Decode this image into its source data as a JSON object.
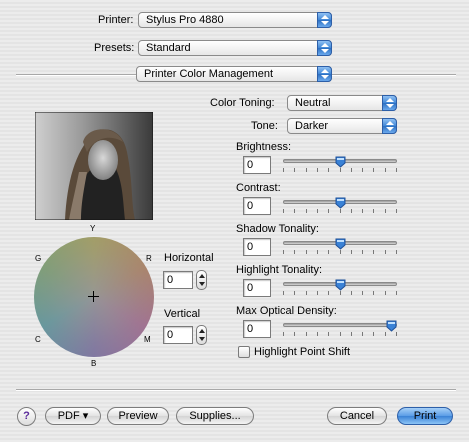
{
  "header": {
    "printer_label": "Printer:",
    "printer_value": "Stylus Pro 4880",
    "presets_label": "Presets:",
    "presets_value": "Standard",
    "panel_value": "Printer Color Management"
  },
  "color_wheel": {
    "labels": {
      "Y": "Y",
      "R": "R",
      "G": "G",
      "C": "C",
      "M": "M",
      "B": "B"
    },
    "horizontal_label": "Horizontal",
    "horizontal_value": "0",
    "vertical_label": "Vertical",
    "vertical_value": "0"
  },
  "color_toning": {
    "label": "Color Toning:",
    "value": "Neutral"
  },
  "tone": {
    "label": "Tone:",
    "value": "Darker"
  },
  "sliders": [
    {
      "label": "Brightness:",
      "value": "0",
      "fraction": 0.5
    },
    {
      "label": "Contrast:",
      "value": "0",
      "fraction": 0.5
    },
    {
      "label": "Shadow Tonality:",
      "value": "0",
      "fraction": 0.5
    },
    {
      "label": "Highlight Tonality:",
      "value": "0",
      "fraction": 0.5
    },
    {
      "label": "Max Optical Density:",
      "value": "0",
      "fraction": 1.0
    }
  ],
  "highlight_point_shift": {
    "label": "Highlight Point Shift",
    "checked": false
  },
  "footer": {
    "help": "?",
    "pdf": "PDF ▾",
    "preview": "Preview",
    "supplies": "Supplies...",
    "cancel": "Cancel",
    "print": "Print"
  },
  "colors": {
    "accent": "#3a82d6"
  }
}
